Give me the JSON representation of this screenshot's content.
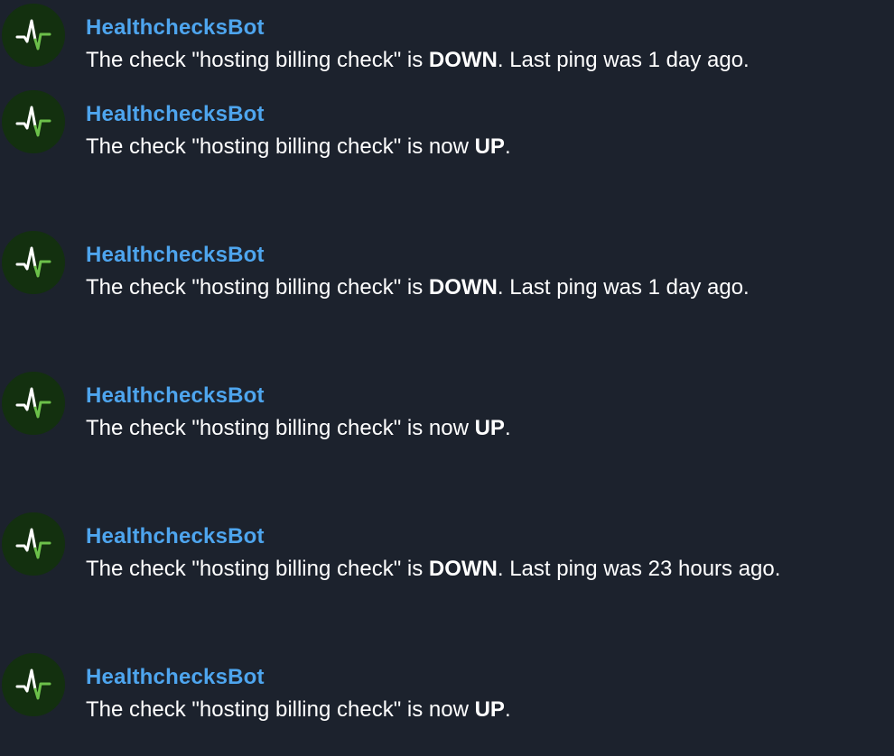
{
  "brand_colors": {
    "background": "#1c222d",
    "sender_name": "#4ea5ee",
    "avatar_bg": "#13300f",
    "pulse_white": "#ffffff",
    "pulse_green": "#6cc04a"
  },
  "avatar_icon": "pulse-icon",
  "messages": [
    {
      "sender": "HealthchecksBot",
      "text_before": "The check \"hosting billing check\" is ",
      "status": "DOWN",
      "text_after": ". Last ping was 1 day ago."
    },
    {
      "sender": "HealthchecksBot",
      "text_before": "The check \"hosting billing check\" is now ",
      "status": "UP",
      "text_after": "."
    },
    {
      "sender": "HealthchecksBot",
      "text_before": "The check \"hosting billing check\" is ",
      "status": "DOWN",
      "text_after": ". Last ping was 1 day ago."
    },
    {
      "sender": "HealthchecksBot",
      "text_before": "The check \"hosting billing check\" is now ",
      "status": "UP",
      "text_after": "."
    },
    {
      "sender": "HealthchecksBot",
      "text_before": "The check \"hosting billing check\" is ",
      "status": "DOWN",
      "text_after": ". Last ping was 23 hours ago."
    },
    {
      "sender": "HealthchecksBot",
      "text_before": "The check \"hosting billing check\" is now ",
      "status": "UP",
      "text_after": "."
    }
  ]
}
